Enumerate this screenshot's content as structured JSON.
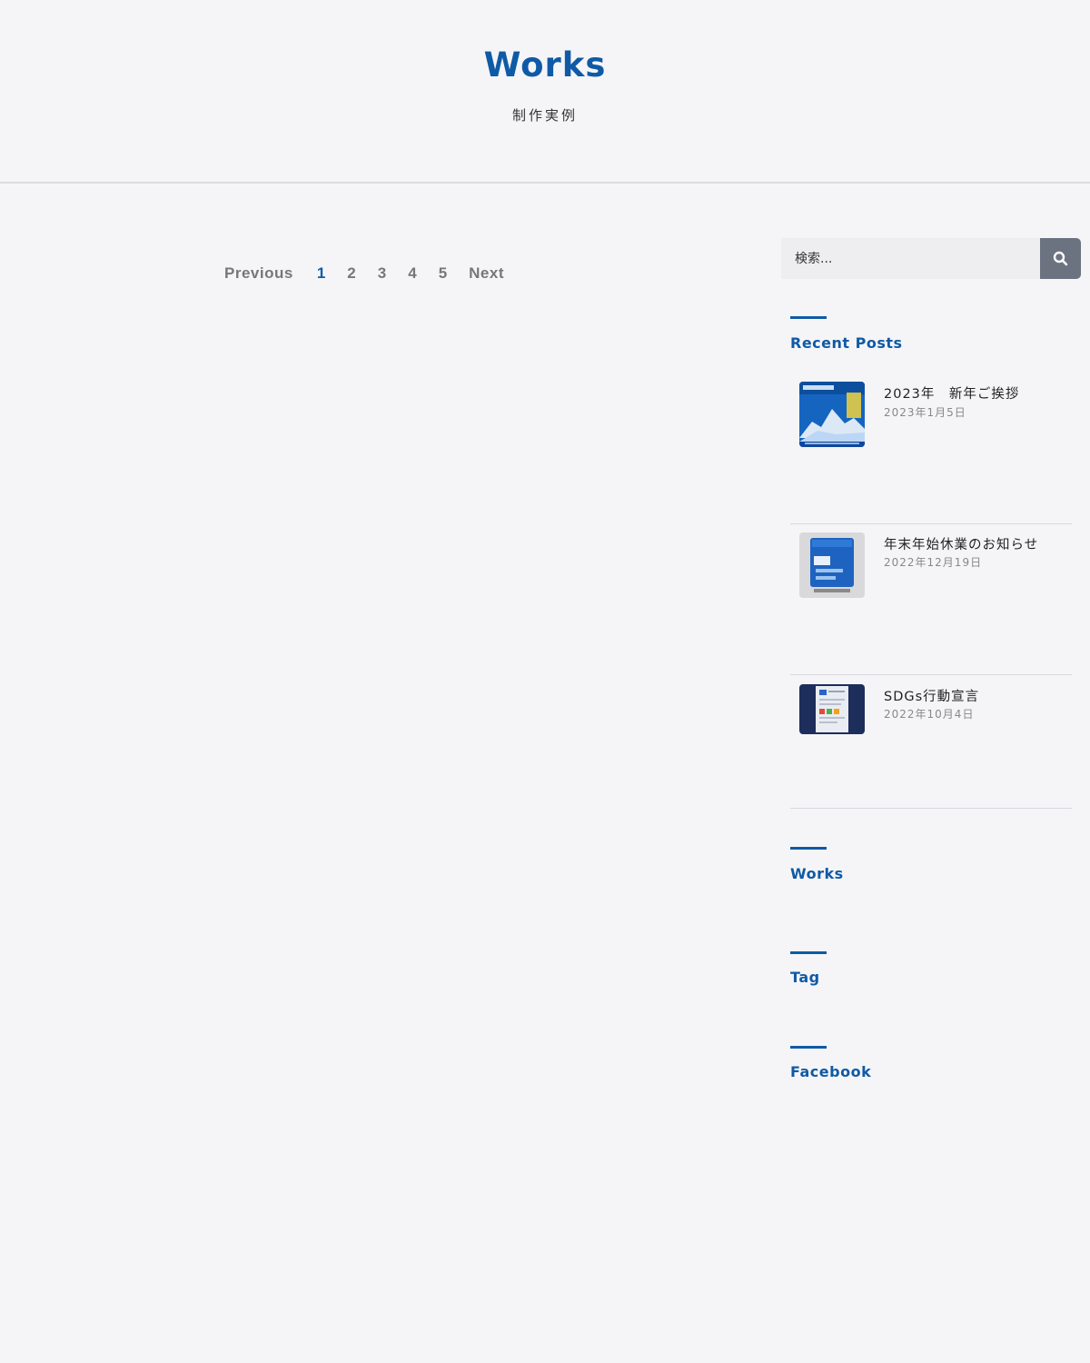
{
  "hero": {
    "title": "Works",
    "subtitle": "制作実例"
  },
  "pagination": {
    "previous": "Previous",
    "pages": [
      "1",
      "2",
      "3",
      "4",
      "5"
    ],
    "current": "1",
    "next": "Next"
  },
  "search": {
    "placeholder": "検索..."
  },
  "sidebar": {
    "recent_posts_title": "Recent Posts",
    "posts": [
      {
        "title": "2023年　新年ご挨拶",
        "date": "2023年1月5日"
      },
      {
        "title": "年末年始休業のお知らせ",
        "date": "2022年12月19日"
      },
      {
        "title": "SDGs行動宣言",
        "date": "2022年10月4日"
      }
    ],
    "works_title": "Works",
    "tag_title": "Tag",
    "facebook_title": "Facebook"
  },
  "colors": {
    "accent": "#0f5aa6",
    "background": "#f5f5f7",
    "search_button": "#6b7280"
  }
}
